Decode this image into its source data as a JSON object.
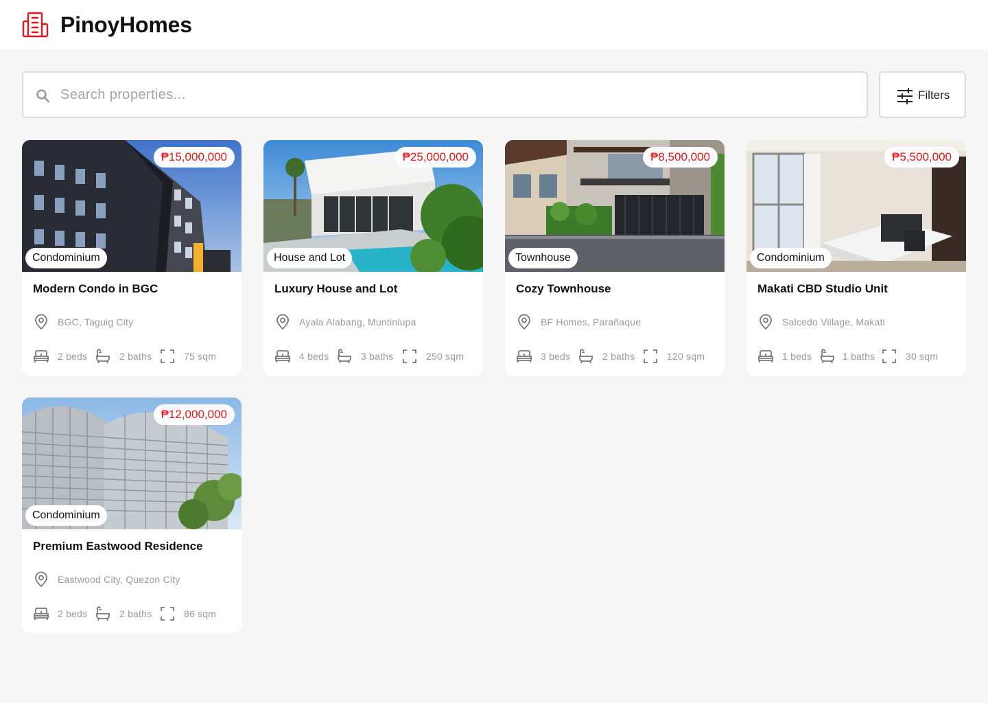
{
  "header": {
    "brand": "PinoyHomes",
    "logo_icon": "building-icon",
    "accent_color": "#e4141a"
  },
  "search": {
    "placeholder": "Search properties...",
    "value": "",
    "icon": "search-icon"
  },
  "filters": {
    "label": "Filters",
    "icon": "sliders-icon"
  },
  "listings": [
    {
      "title": "Modern Condo in BGC",
      "price": "₱15,000,000",
      "type": "Condominium",
      "location": "BGC, Taguig City",
      "beds": "2 beds",
      "baths": "2 baths",
      "area": "75 sqm"
    },
    {
      "title": "Luxury House and Lot",
      "price": "₱25,000,000",
      "type": "House and Lot",
      "location": "Ayala Alabang, Muntinlupa",
      "beds": "4 beds",
      "baths": "3 baths",
      "area": "250 sqm"
    },
    {
      "title": "Cozy Townhouse",
      "price": "₱8,500,000",
      "type": "Townhouse",
      "location": "BF Homes, Parañaque",
      "beds": "3 beds",
      "baths": "2 baths",
      "area": "120 sqm"
    },
    {
      "title": "Makati CBD Studio Unit",
      "price": "₱5,500,000",
      "type": "Condominium",
      "location": "Salcedo Village, Makati",
      "beds": "1 beds",
      "baths": "1 baths",
      "area": "30 sqm"
    },
    {
      "title": "Premium Eastwood Residence",
      "price": "₱12,000,000",
      "type": "Condominium",
      "location": "Eastwood City, Quezon City",
      "beds": "2 beds",
      "baths": "2 baths",
      "area": "86 sqm"
    }
  ]
}
